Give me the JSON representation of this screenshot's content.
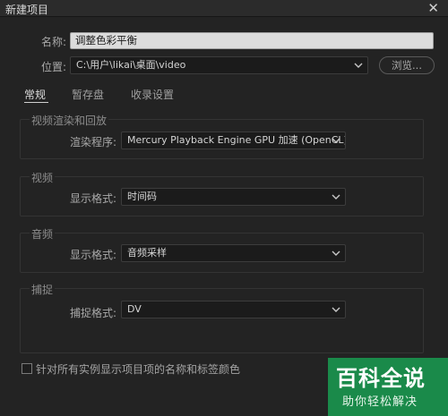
{
  "window": {
    "title": "新建项目",
    "close_icon": "close-icon"
  },
  "fields": {
    "name_label": "名称:",
    "name_value": "调整色彩平衡",
    "location_label": "位置:",
    "location_value": "C:\\用户\\likai\\桌面\\video",
    "browse_label": "浏览..."
  },
  "tabs": [
    {
      "label": "常规",
      "active": true
    },
    {
      "label": "暂存盘",
      "active": false
    },
    {
      "label": "收录设置",
      "active": false
    }
  ],
  "groups": {
    "render": {
      "title": "视频渲染和回放",
      "label": "渲染程序:",
      "value": "Mercury Playback Engine GPU 加速 (OpenCL)"
    },
    "video": {
      "title": "视频",
      "label": "显示格式:",
      "value": "时间码"
    },
    "audio": {
      "title": "音频",
      "label": "显示格式:",
      "value": "音频采样"
    },
    "capture": {
      "title": "捕捉",
      "label": "捕捉格式:",
      "value": "DV"
    }
  },
  "checkbox": {
    "label": "针对所有实例显示项目项的名称和标签颜色",
    "checked": false
  },
  "watermark": {
    "main": "百科全说",
    "sub": "助你轻松解决"
  },
  "colors": {
    "background": "#232323",
    "watermark": "#1a8a4a"
  }
}
